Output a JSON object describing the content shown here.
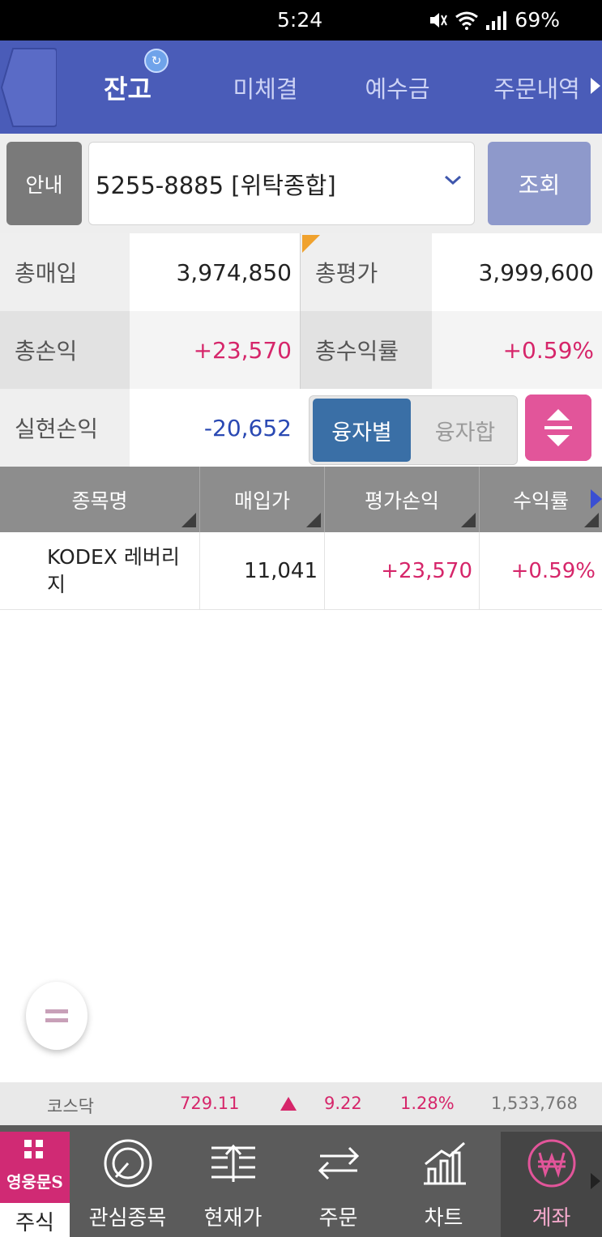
{
  "status_bar": {
    "time": "5:24",
    "battery": "69%",
    "icons": [
      "mute-icon",
      "wifi-icon",
      "signal-icon"
    ]
  },
  "top_tabs": {
    "tabs": [
      {
        "label": "잔고",
        "active": true
      },
      {
        "label": "미체결",
        "active": false
      },
      {
        "label": "예수금",
        "active": false
      },
      {
        "label": "주문내역",
        "active": false
      }
    ]
  },
  "account": {
    "info_label": "안내",
    "selected": "5255-8885 [위탁종합]",
    "query_label": "조회"
  },
  "summary": {
    "total_purchase_label": "총매입",
    "total_purchase": "3,974,850",
    "total_eval_label": "총평가",
    "total_eval": "3,999,600",
    "total_pl_label": "총손익",
    "total_pl": "+23,570",
    "total_return_label": "총수익률",
    "total_return": "+0.59%",
    "realized_pl_label": "실현손익",
    "realized_pl": "-20,652",
    "toggle_on": "융자별",
    "toggle_off": "융자합"
  },
  "table": {
    "headers": [
      "종목명",
      "매입가",
      "평가손익",
      "수익률"
    ],
    "rows": [
      {
        "name": "KODEX 레버리지",
        "buy_price": "11,041",
        "eval_pl": "+23,570",
        "return": "+0.59%"
      }
    ]
  },
  "ticker": {
    "index": "코스닥",
    "value": "729.11",
    "change": "9.22",
    "pct": "1.28%",
    "volume": "1,533,768"
  },
  "bottom_nav": {
    "home_brand": "영웅문S",
    "items": [
      "주식",
      "관심종목",
      "현재가",
      "주문",
      "차트",
      "계좌"
    ]
  },
  "colors": {
    "accent": "#4a5cb8",
    "up": "#d6266a",
    "down": "#2a49b3",
    "brand": "#d02a74"
  }
}
